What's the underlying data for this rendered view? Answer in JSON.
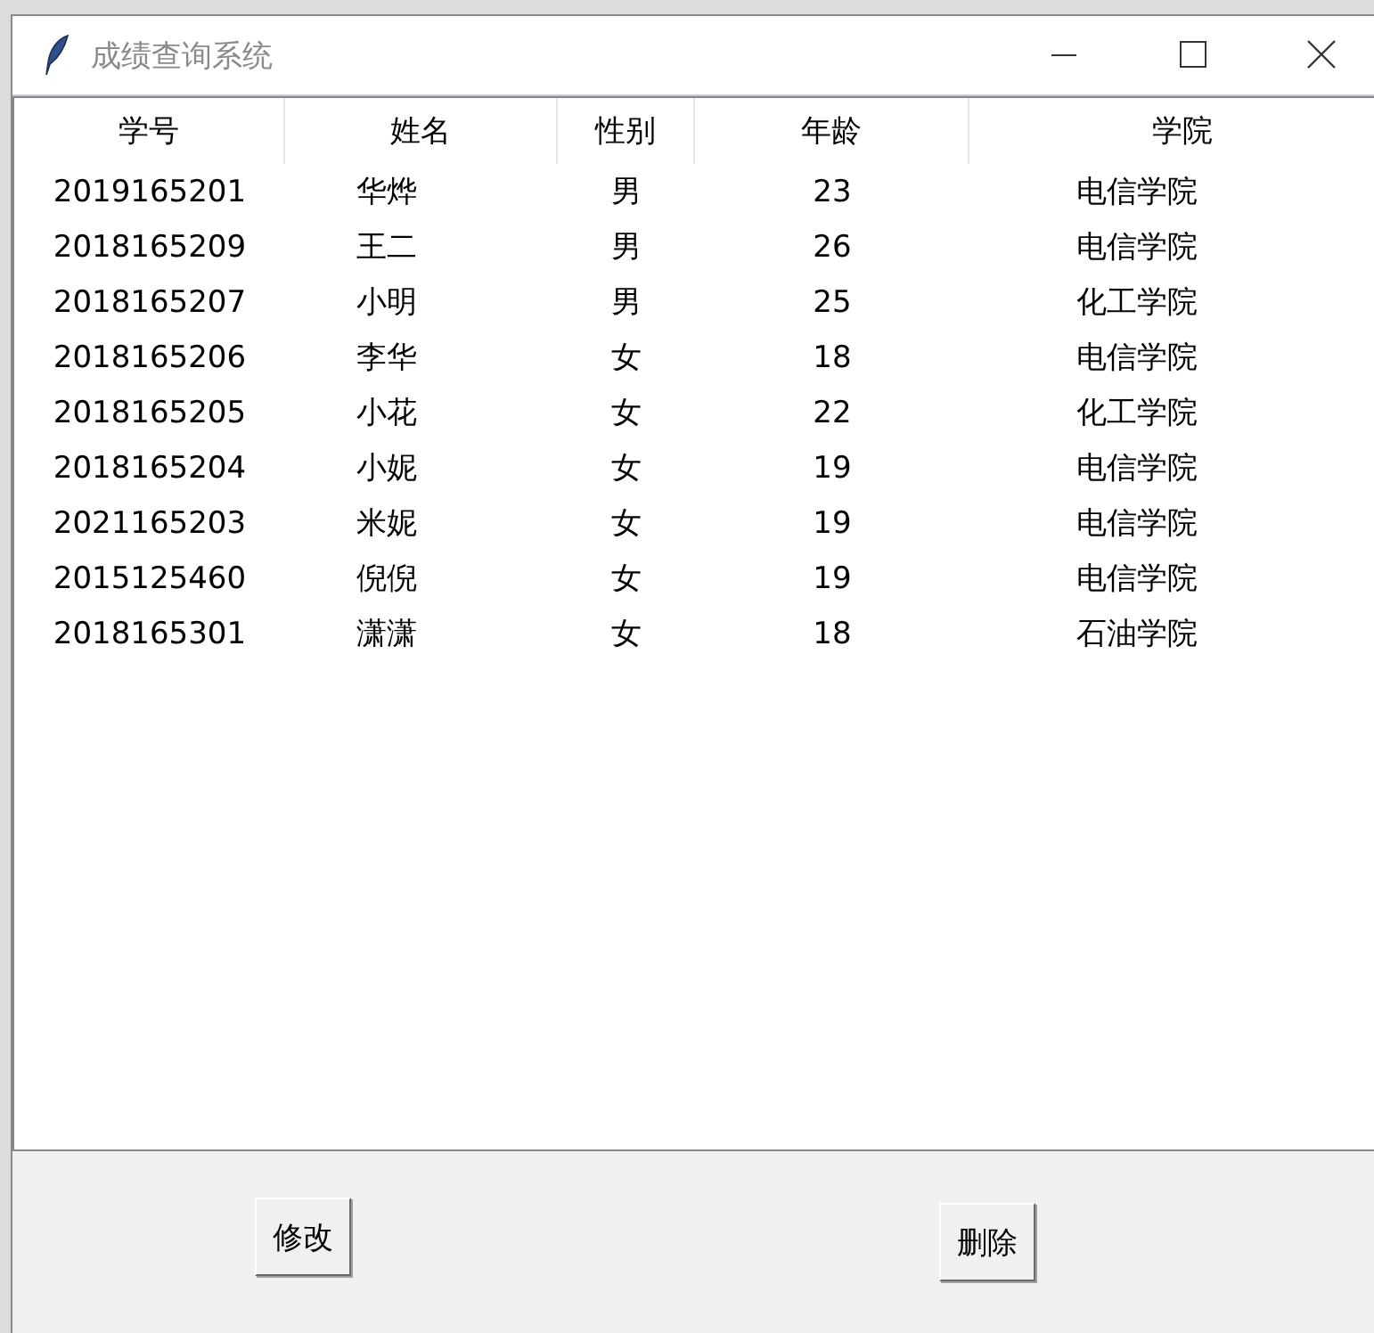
{
  "window": {
    "title": "成绩查询系统"
  },
  "table": {
    "columns": [
      "学号",
      "姓名",
      "性别",
      "年龄",
      "学院"
    ],
    "rows": [
      [
        "2019165201",
        "华烨",
        "男",
        "23",
        "电信学院"
      ],
      [
        "2018165209",
        "王二",
        "男",
        "26",
        "电信学院"
      ],
      [
        "2018165207",
        "小明",
        "男",
        "25",
        "化工学院"
      ],
      [
        "2018165206",
        "李华",
        "女",
        "18",
        "电信学院"
      ],
      [
        "2018165205",
        "小花",
        "女",
        "22",
        "化工学院"
      ],
      [
        "2018165204",
        "小妮",
        "女",
        "19",
        "电信学院"
      ],
      [
        "2021165203",
        "米妮",
        "女",
        "19",
        "电信学院"
      ],
      [
        "2015125460",
        "倪倪",
        "女",
        "19",
        "电信学院"
      ],
      [
        "2018165301",
        "潇潇",
        "女",
        "18",
        "石油学院"
      ]
    ]
  },
  "buttons": [
    "修改",
    "删除"
  ]
}
